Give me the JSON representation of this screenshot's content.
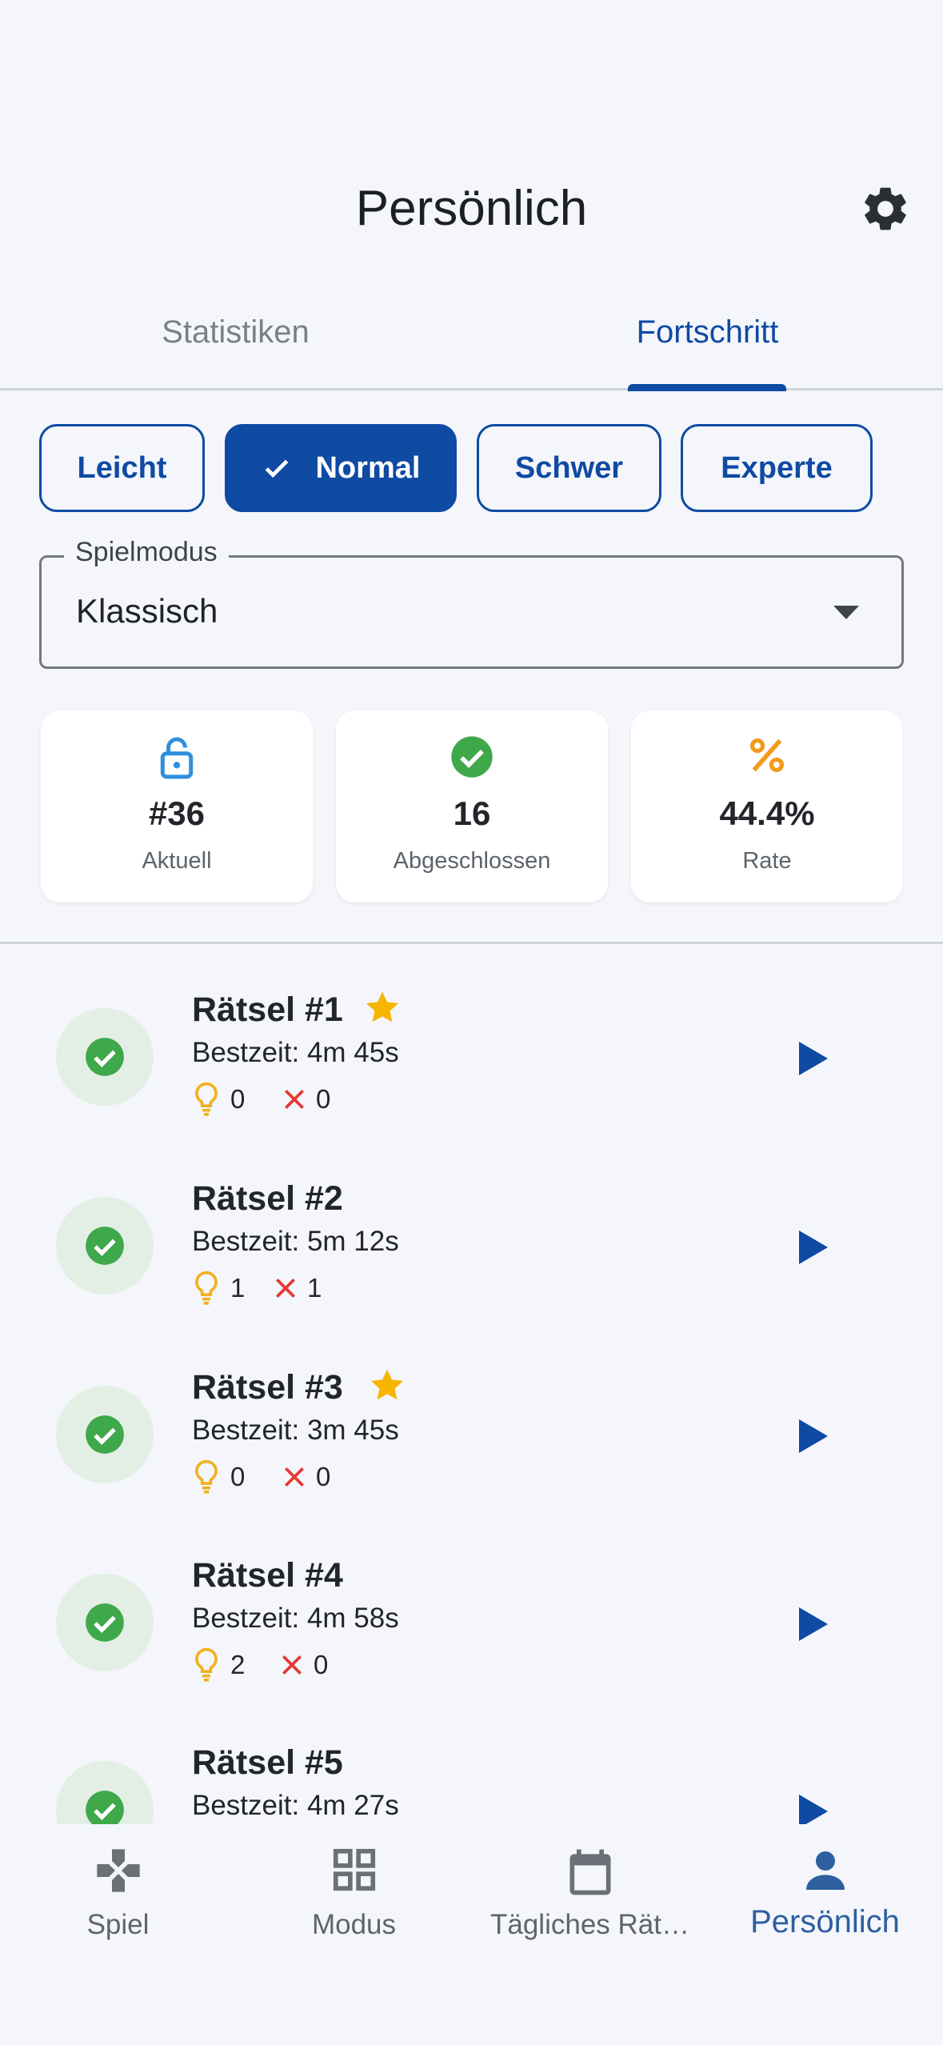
{
  "header": {
    "title": "Persönlich",
    "settings_icon": "gear-icon"
  },
  "tabs": [
    {
      "label": "Statistiken",
      "active": false
    },
    {
      "label": "Fortschritt",
      "active": true
    }
  ],
  "difficulty": [
    {
      "label": "Leicht",
      "selected": false
    },
    {
      "label": "Normal",
      "selected": true
    },
    {
      "label": "Schwer",
      "selected": false
    },
    {
      "label": "Experte",
      "selected": false
    }
  ],
  "game_mode": {
    "label": "Spielmodus",
    "value": "Klassisch"
  },
  "stats": [
    {
      "icon": "lock-open-icon",
      "value": "#36",
      "label": "Aktuell",
      "color": "#2f8fdc"
    },
    {
      "icon": "check-circle-icon",
      "value": "16",
      "label": "Abgeschlossen",
      "color": "#3fa84a"
    },
    {
      "icon": "percent-icon",
      "value": "44.4%",
      "label": "Rate",
      "color": "#f29a1a"
    }
  ],
  "puzzles": [
    {
      "title": "Rätsel #1",
      "starred": true,
      "best_time": "Bestzeit: 4m 45s",
      "hints": "0",
      "errors": "0"
    },
    {
      "title": "Rätsel #2",
      "starred": false,
      "best_time": "Bestzeit: 5m 12s",
      "hints": "1",
      "errors": "1"
    },
    {
      "title": "Rätsel #3",
      "starred": true,
      "best_time": "Bestzeit: 3m 45s",
      "hints": "0",
      "errors": "0"
    },
    {
      "title": "Rätsel #4",
      "starred": false,
      "best_time": "Bestzeit: 4m 58s",
      "hints": "2",
      "errors": "0"
    },
    {
      "title": "Rätsel #5",
      "starred": false,
      "best_time": "Bestzeit: 4m 27s",
      "hints": "",
      "errors": ""
    }
  ],
  "nav": [
    {
      "label": "Spiel",
      "icon": "gamepad-icon",
      "active": false
    },
    {
      "label": "Modus",
      "icon": "grid-icon",
      "active": false
    },
    {
      "label": "Tägliches Rät…",
      "icon": "calendar-icon",
      "active": false
    },
    {
      "label": "Persönlich",
      "icon": "person-icon",
      "active": true
    }
  ],
  "colors": {
    "accent": "#0f4aa3",
    "success": "#3fa84a",
    "star": "#f7b500",
    "error": "#e53935",
    "hint": "#f2b01e",
    "background": "#f4f6fb"
  }
}
